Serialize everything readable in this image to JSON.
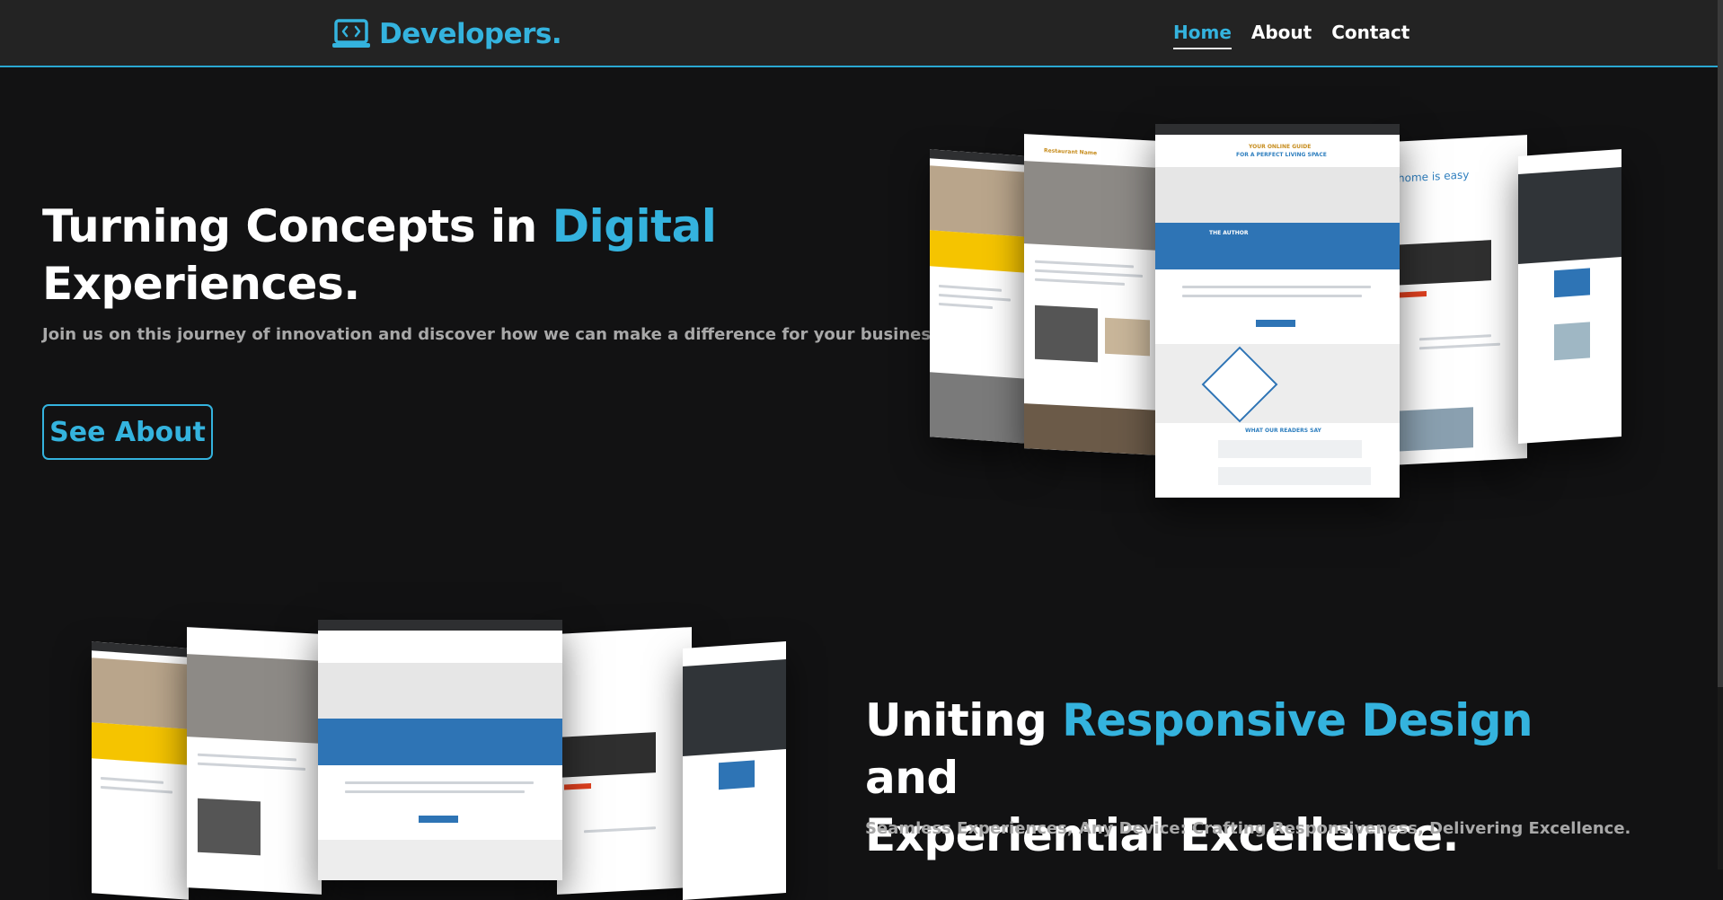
{
  "header": {
    "brand_name": "Developers.",
    "nav": [
      {
        "label": "Home",
        "active": true
      },
      {
        "label": "About",
        "active": false
      },
      {
        "label": "Contact",
        "active": false
      }
    ]
  },
  "hero": {
    "title_part1": "Turning Concepts in ",
    "title_accent": "Digital",
    "title_part2": "Experiences.",
    "subtitle": "Join us on this journey of innovation and discover how we can make a difference for your business.",
    "cta_label": "See About"
  },
  "section2": {
    "title_part1": "Uniting ",
    "title_accent": "Responsive Design",
    "title_part2": " and",
    "title_line2": "Experiential Excellence.",
    "subtitle": "Seamless Experiences, Any Device: Crafting Responsiveness, Delivering Excellence."
  },
  "mockup": {
    "headline_small": "YOUR ONLINE GUIDE",
    "headline_big": "FOR A PERFECT LIVING SPACE",
    "author_label": "THE AUTHOR",
    "readers_label": "WHAT OUR READERS SAY",
    "restaurant_label": "Restaurant Name",
    "home_easy_label": "home is easy"
  },
  "colors": {
    "accent": "#34b3de",
    "background": "#121213",
    "header_bg": "#232323",
    "mockup_blue": "#2e74b5",
    "mockup_yellow": "#f5c400"
  },
  "icons": {
    "brand": "laptop-code-icon"
  }
}
